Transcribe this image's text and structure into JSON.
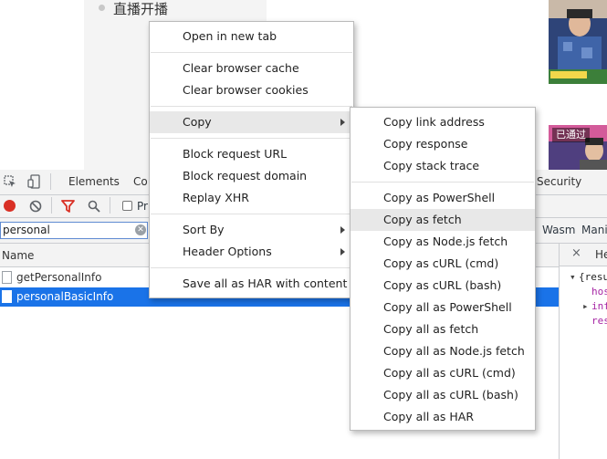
{
  "page": {
    "list_item": "直播开播",
    "thumb2_badge": "已通过"
  },
  "devtools": {
    "tabs": [
      "Elements",
      "Co",
      "Security"
    ],
    "preserve_log_label": "Pr",
    "filter_value": "personal",
    "filter_types_partial": [
      "Wasm",
      "Manit"
    ],
    "column_name": "Name",
    "requests": [
      "getPersonalInfo",
      "personalBasicInfo"
    ],
    "right_panel": {
      "tab_partial": "He",
      "code_lines": [
        "{resu",
        "hos",
        "inf",
        "res"
      ]
    }
  },
  "context_menu": {
    "items": [
      "Open in new tab",
      "Clear browser cache",
      "Clear browser cookies",
      "Copy",
      "Block request URL",
      "Block request domain",
      "Replay XHR",
      "Sort By",
      "Header Options",
      "Save all as HAR with content"
    ]
  },
  "copy_submenu": {
    "items": [
      "Copy link address",
      "Copy response",
      "Copy stack trace",
      "Copy as PowerShell",
      "Copy as fetch",
      "Copy as Node.js fetch",
      "Copy as cURL (cmd)",
      "Copy as cURL (bash)",
      "Copy all as PowerShell",
      "Copy all as fetch",
      "Copy all as Node.js fetch",
      "Copy all as cURL (cmd)",
      "Copy all as cURL (bash)",
      "Copy all as HAR"
    ],
    "highlighted": "Copy as fetch"
  },
  "colors": {
    "selected_row": "#1a73e8",
    "menu_hover": "#e8e8e8",
    "record_red": "#d93025",
    "filter_red": "#d93025"
  }
}
